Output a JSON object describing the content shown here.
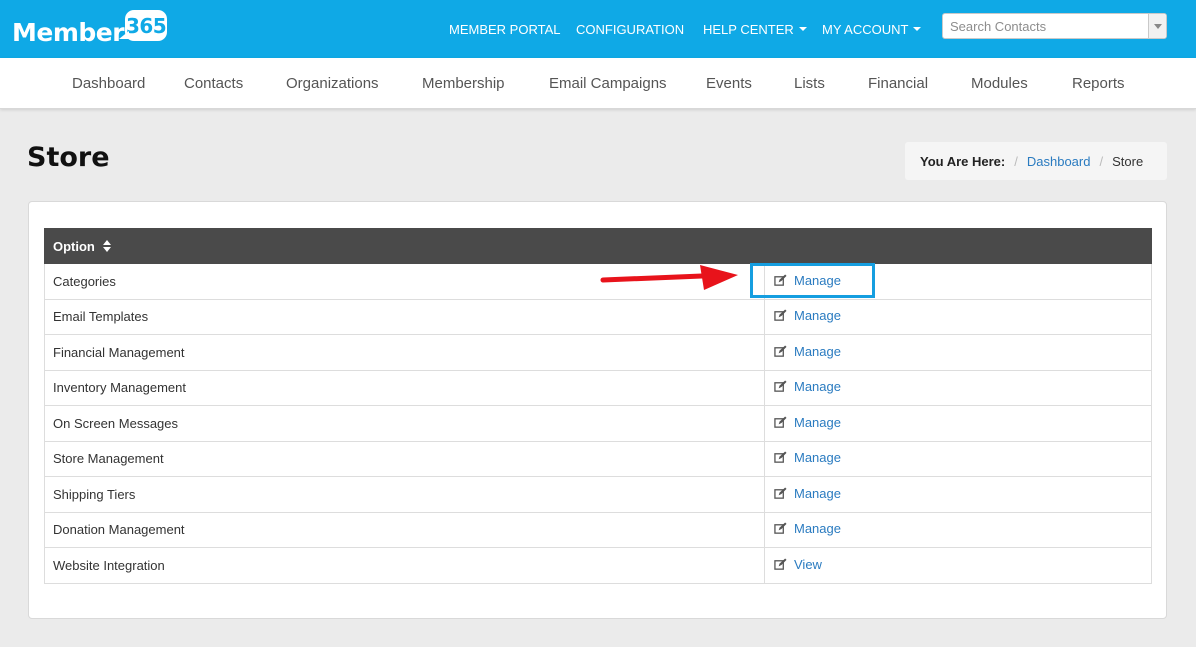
{
  "logo": {
    "word": "Member",
    "badge": "365"
  },
  "topnav": {
    "member_portal": "MEMBER PORTAL",
    "configuration": "CONFIGURATION",
    "help_center": "HELP CENTER",
    "my_account": "MY ACCOUNT"
  },
  "search": {
    "placeholder": "Search Contacts"
  },
  "mainnav": {
    "items": [
      "Dashboard",
      "Contacts",
      "Organizations",
      "Membership",
      "Email Campaigns",
      "Events",
      "Lists",
      "Financial",
      "Modules",
      "Reports"
    ]
  },
  "page": {
    "title": "Store"
  },
  "breadcrumb": {
    "label": "You Are Here:",
    "link": "Dashboard",
    "current": "Store"
  },
  "table": {
    "header": {
      "option": "Option",
      "action": ""
    },
    "rows": [
      {
        "option": "Categories",
        "action": "Manage"
      },
      {
        "option": "Email Templates",
        "action": "Manage"
      },
      {
        "option": "Financial Management",
        "action": "Manage"
      },
      {
        "option": "Inventory Management",
        "action": "Manage"
      },
      {
        "option": "On Screen Messages",
        "action": "Manage"
      },
      {
        "option": "Store Management",
        "action": "Manage"
      },
      {
        "option": "Shipping Tiers",
        "action": "Manage"
      },
      {
        "option": "Donation Management",
        "action": "Manage"
      },
      {
        "option": "Website Integration",
        "action": "View"
      }
    ]
  },
  "colors": {
    "topbar": "#0fa9e6",
    "link": "#2a7bc0",
    "table_header": "#4a4a4a",
    "highlight": "#159ee0",
    "arrow": "#e8131b"
  }
}
